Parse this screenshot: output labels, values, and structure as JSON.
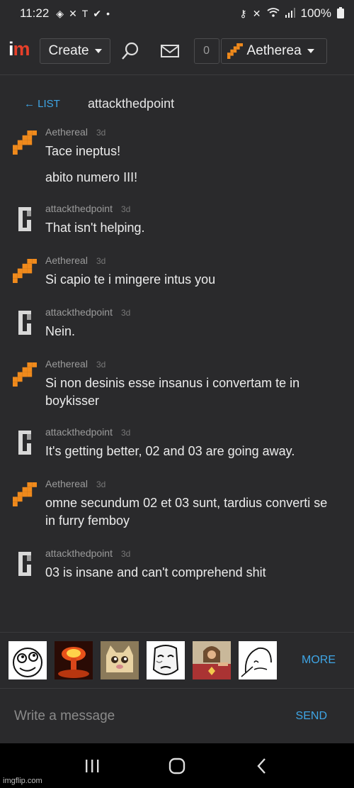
{
  "status_bar": {
    "time": "11:22",
    "battery": "100%"
  },
  "nav": {
    "logo_i": "i",
    "logo_m": "m",
    "create_label": "Create",
    "notif_count": "0",
    "username": "Aetherea"
  },
  "thread": {
    "back_label": "← LIST",
    "title": "attackthedpoint"
  },
  "messages": [
    {
      "user": "Aethereal",
      "time": "3d",
      "avatar": "orange",
      "lines": [
        "Tace ineptus!",
        "abito numero III!"
      ]
    },
    {
      "user": "attackthedpoint",
      "time": "3d",
      "avatar": "gray",
      "lines": [
        "That isn't helping."
      ]
    },
    {
      "user": "Aethereal",
      "time": "3d",
      "avatar": "orange",
      "lines": [
        "Si capio te i mingere intus you"
      ]
    },
    {
      "user": "attackthedpoint",
      "time": "3d",
      "avatar": "gray",
      "lines": [
        "Nein."
      ]
    },
    {
      "user": "Aethereal",
      "time": "3d",
      "avatar": "orange",
      "lines": [
        "Si non desinis esse insanus i convertam te in boykisser"
      ]
    },
    {
      "user": "attackthedpoint",
      "time": "3d",
      "avatar": "gray",
      "lines": [
        "It's getting better, 02 and 03 are going away."
      ]
    },
    {
      "user": "Aethereal",
      "time": "3d",
      "avatar": "orange",
      "lines": [
        "omne secundum 02 et 03 sunt, tardius converti se in furry femboy"
      ]
    },
    {
      "user": "attackthedpoint",
      "time": "3d",
      "avatar": "gray",
      "lines": [
        "03 is insane and can't comprehend shit"
      ]
    }
  ],
  "meme_bar": {
    "thumbs": [
      "derp-face",
      "nuclear-explosion",
      "crying-cat",
      "okay-face",
      "buddy-christ",
      "wojak-sketch"
    ],
    "more_label": "MORE"
  },
  "composer": {
    "placeholder": "Write a message",
    "send_label": "SEND"
  },
  "watermark": "imgflip.com",
  "colors": {
    "accent": "#3fa6e6",
    "brand_orange": "#f08a1c",
    "background": "#2a2a2c"
  }
}
